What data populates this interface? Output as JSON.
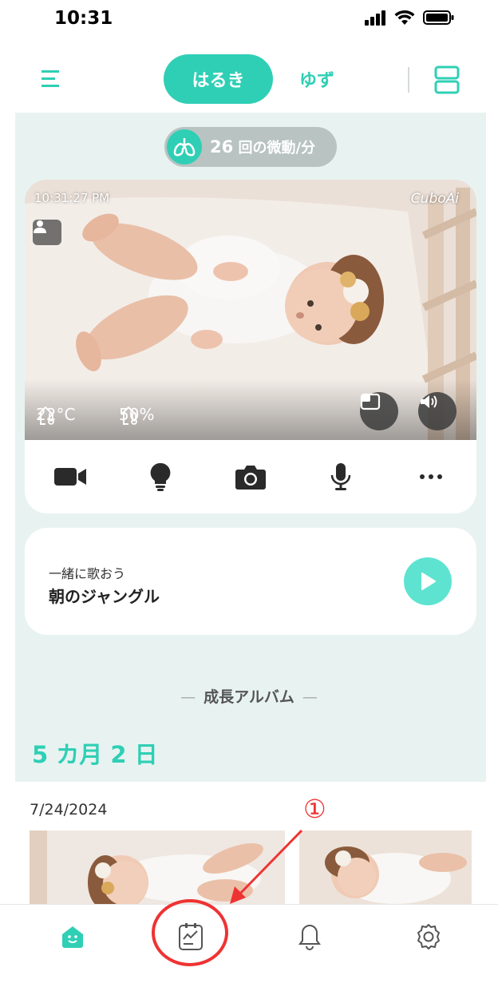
{
  "status": {
    "time": "10:31"
  },
  "header": {
    "tabs": [
      {
        "label": "はるき",
        "active": true
      },
      {
        "label": "ゆず",
        "active": false
      }
    ],
    "menu_icon": "menu-icon",
    "layout_icon": "split-view-icon"
  },
  "breathing": {
    "count": "26",
    "text": "回の微動/分"
  },
  "camera": {
    "timestamp": "10:31:27 PM",
    "brand": "CuboAi",
    "temperature": "22°C",
    "humidity": "50%",
    "controls": [
      "video-icon",
      "light-bulb-icon",
      "camera-icon",
      "microphone-icon",
      "more-icon"
    ]
  },
  "song": {
    "subtitle": "一緒に歌おう",
    "title": "朝のジャングル"
  },
  "album": {
    "heading": "成長アルバム",
    "age": "5 カ月 2 日",
    "date": "7/24/2024"
  },
  "annotation": {
    "number": "①"
  },
  "colors": {
    "accent": "#2fcfb5",
    "annotation": "#e33333"
  },
  "tabbar": [
    "home-icon",
    "report-icon",
    "bell-icon",
    "settings-icon"
  ]
}
